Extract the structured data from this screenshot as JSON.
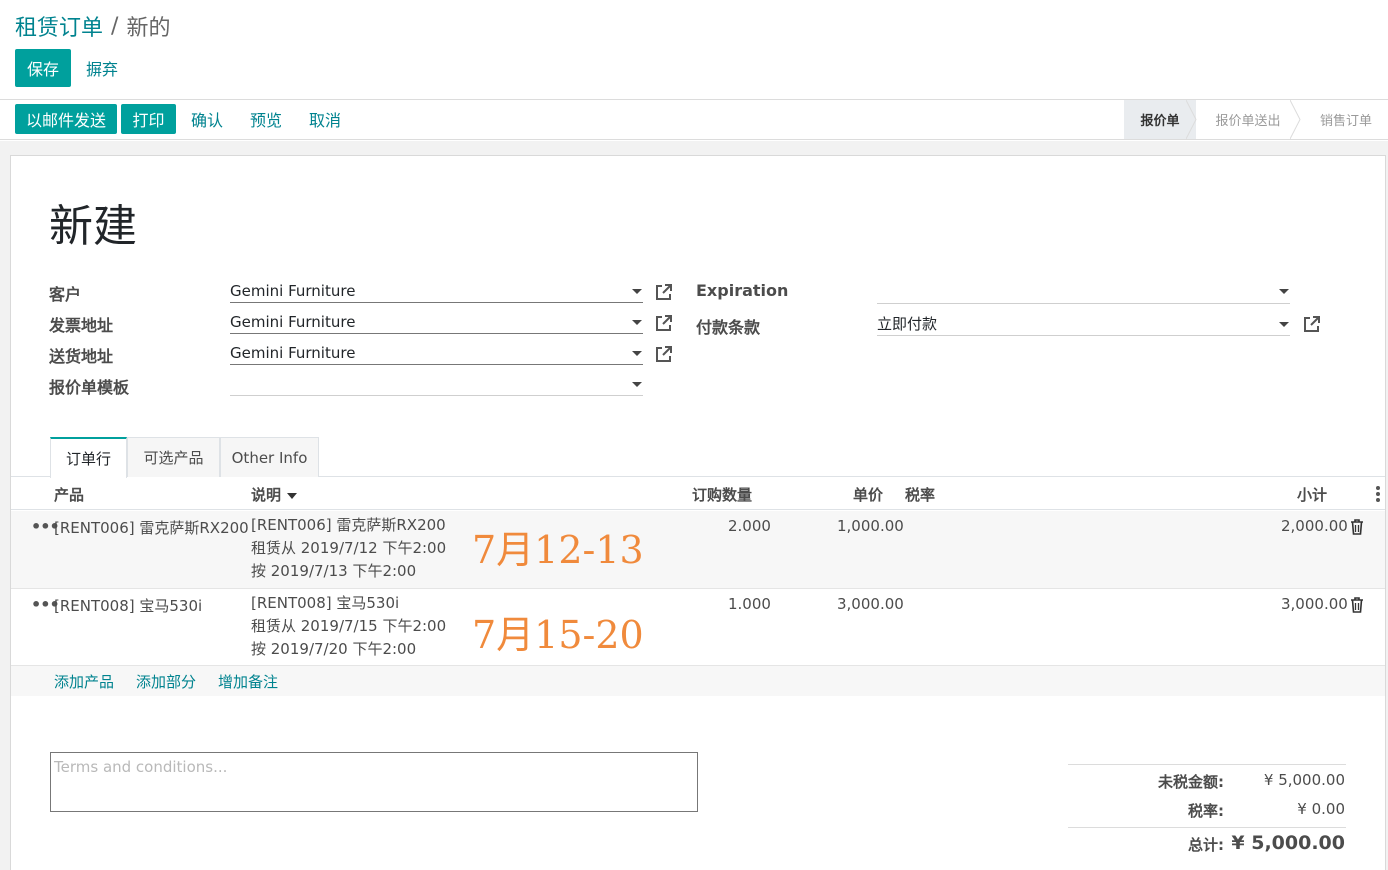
{
  "breadcrumb": {
    "parent": "租赁订单",
    "separator": "/",
    "current": "新的"
  },
  "control": {
    "save": "保存",
    "discard": "摒弃"
  },
  "actions": {
    "send_email": "以邮件发送",
    "print": "打印",
    "confirm": "确认",
    "preview": "预览",
    "cancel": "取消"
  },
  "stages": [
    {
      "label": "报价单",
      "active": true
    },
    {
      "label": "报价单送出",
      "active": false
    },
    {
      "label": "销售订单",
      "active": false
    }
  ],
  "record": {
    "title": "新建"
  },
  "fields": {
    "customer": {
      "label": "客户",
      "value": "Gemini Furniture"
    },
    "invoice_address": {
      "label": "发票地址",
      "value": "Gemini Furniture"
    },
    "delivery_address": {
      "label": "送货地址",
      "value": "Gemini Furniture"
    },
    "quotation_template": {
      "label": "报价单模板",
      "value": ""
    },
    "expiration": {
      "label": "Expiration",
      "value": ""
    },
    "payment_terms": {
      "label": "付款条款",
      "value": "立即付款"
    }
  },
  "tabs": [
    {
      "label": "订单行",
      "active": true
    },
    {
      "label": "可选产品",
      "active": false
    },
    {
      "label": "Other Info",
      "active": false
    }
  ],
  "table": {
    "headers": {
      "product": "产品",
      "description": "说明",
      "quantity": "订购数量",
      "unit_price": "单价",
      "taxes": "税率",
      "subtotal": "小计"
    },
    "rows": [
      {
        "product": "[RENT006] 雷克萨斯RX200",
        "description": [
          "[RENT006] 雷克萨斯RX200",
          "租赁从 2019/7/12 下午2:00",
          "按 2019/7/13 下午2:00"
        ],
        "quantity": "2.000",
        "unit_price": "1,000.00",
        "taxes": "",
        "subtotal": "2,000.00",
        "note": "7月12-13"
      },
      {
        "product": "[RENT008] 宝马530i",
        "description": [
          "[RENT008] 宝马530i",
          "租赁从 2019/7/15 下午2:00",
          "按 2019/7/20 下午2:00"
        ],
        "quantity": "1.000",
        "unit_price": "3,000.00",
        "taxes": "",
        "subtotal": "3,000.00",
        "note": "7月15-20"
      }
    ],
    "add_product": "添加产品",
    "add_section": "添加部分",
    "add_note": "增加备注"
  },
  "terms": {
    "placeholder": "Terms and conditions..."
  },
  "totals": {
    "untaxed_label": "未税金额:",
    "untaxed_value": "¥ 5,000.00",
    "taxes_label": "税率:",
    "taxes_value": "¥ 0.00",
    "total_label": "总计:",
    "total_value": "¥ 5,000.00"
  },
  "colors": {
    "primary": "#00a09d",
    "link": "#00838f",
    "annotation": "#f08a3c"
  }
}
